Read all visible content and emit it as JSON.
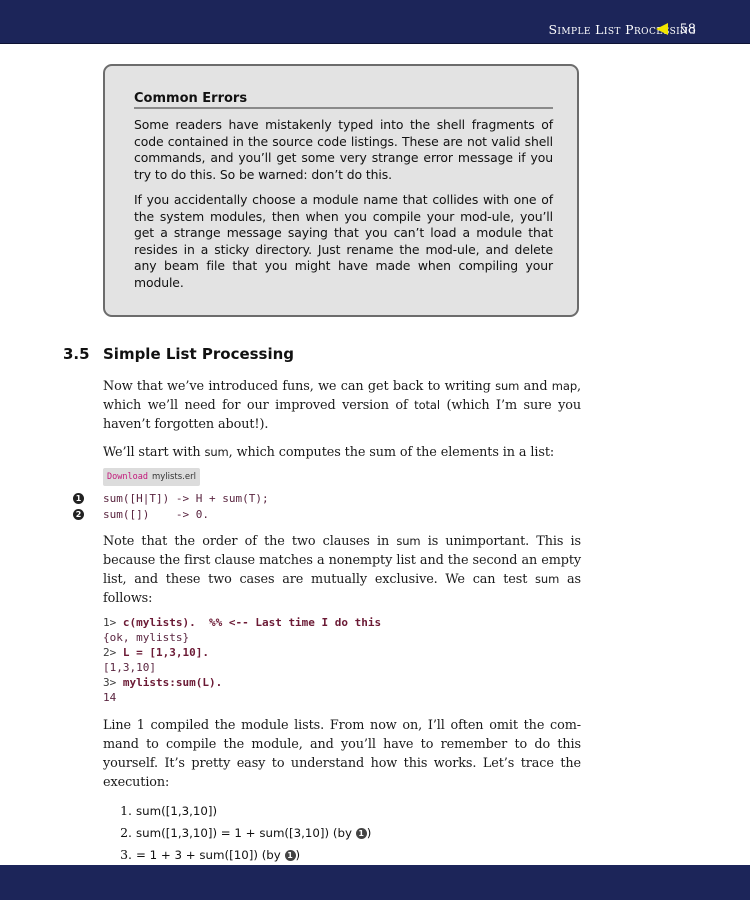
{
  "header": {
    "running_head": "Simple List Processing",
    "page_number": "58",
    "arrow_icon": "left-triangle-icon"
  },
  "sidebar": {
    "title": "Common Errors",
    "paragraphs": [
      "Some readers have mistakenly typed into the shell fragments of code contained in the source code listings. These are not valid shell commands, and you’ll get some very strange error message if you try to do this. So be warned: don’t do this.",
      "If you accidentally choose a module name that collides with one of the system modules, then when you compile your mod-ule, you’ll get a strange message saying that you can’t load a module that resides in a sticky directory. Just rename the mod-ule, and delete any beam file that you might have made when compiling your module."
    ]
  },
  "section": {
    "number": "3.5",
    "title": "Simple List Processing"
  },
  "body": {
    "p1": {
      "a": "Now that we’ve introduced funs, we can get back to writing ",
      "sum": "sum",
      "b": " and ",
      "map": "map",
      "c": ", which we’ll need for our improved version of ",
      "total": "total",
      "d": " (which I’m sure you haven’t forgotten about!)."
    },
    "p2": {
      "a": "We’ll start with ",
      "sum": "sum",
      "b": ", which computes the sum of the elements in a list:"
    },
    "download": {
      "label": "Download",
      "file": "mylists.erl"
    },
    "listing": {
      "markers": [
        "1",
        "2"
      ],
      "lines": [
        "sum([H|T]) -> H + sum(T);",
        "sum([])    -> 0."
      ]
    },
    "p3": {
      "a": "Note that the order of the two clauses in ",
      "sum": "sum",
      "b": " is unimportant. This is because the first clause matches a nonempty list and the second an empty list, and these two cases are mutually exclusive. We can test ",
      "sum2": "sum",
      "c": " as follows:"
    },
    "shell": [
      {
        "prompt": "1> ",
        "input": "c(mylists).  %% <-- Last time I do this"
      },
      {
        "output": "{ok, mylists}"
      },
      {
        "prompt": "2> ",
        "input": "L = [1,3,10]."
      },
      {
        "output": "[1,3,10]"
      },
      {
        "prompt": "3> ",
        "input": "mylists:sum(L)."
      },
      {
        "output": "14"
      }
    ],
    "p4": "Line 1 compiled the module lists. From now on, I’ll often omit the com-mand to compile the module, and you’ll have to remember to do this yourself. It’s pretty easy to understand how this works. Let’s trace the execution:",
    "trace": [
      {
        "num": "1.",
        "text": "sum([1,3,10])",
        "by": "",
        "marker": ""
      },
      {
        "num": "2.",
        "text": "sum([1,3,10]) = 1 + sum([3,10]) (by ",
        "marker": "1",
        "after": ")"
      },
      {
        "num": "3.",
        "text": "= 1 + 3 + sum([10]) (by ",
        "marker": "1",
        "after": ")"
      }
    ]
  }
}
